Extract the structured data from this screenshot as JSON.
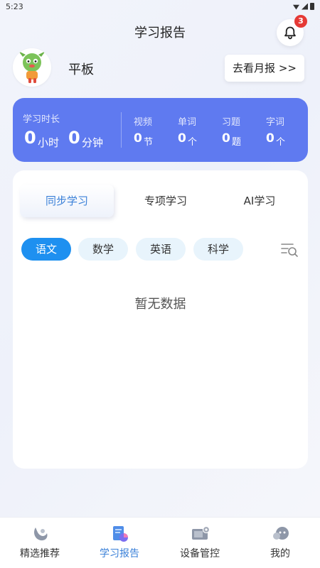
{
  "status_bar": {
    "time": "5:23"
  },
  "header": {
    "title": "学习报告",
    "notification_count": "3"
  },
  "profile": {
    "name": "平板",
    "report_button": "去看月报 >>"
  },
  "stats": {
    "study_time_label": "学习时长",
    "hours_value": "0",
    "hours_unit": "小时",
    "minutes_value": "0",
    "minutes_unit": "分钟",
    "items": [
      {
        "label": "视频",
        "value": "0",
        "unit": "节"
      },
      {
        "label": "单词",
        "value": "0",
        "unit": "个"
      },
      {
        "label": "习题",
        "value": "0",
        "unit": "题"
      },
      {
        "label": "字词",
        "value": "0",
        "unit": "个"
      }
    ]
  },
  "tabs": [
    {
      "label": "同步学习",
      "active": true
    },
    {
      "label": "专项学习",
      "active": false
    },
    {
      "label": "AI学习",
      "active": false
    }
  ],
  "subjects": [
    {
      "label": "语文",
      "active": true
    },
    {
      "label": "数学",
      "active": false
    },
    {
      "label": "英语",
      "active": false
    },
    {
      "label": "科学",
      "active": false
    }
  ],
  "empty_state": "暂无数据",
  "bottom_nav": [
    {
      "label": "精选推荐",
      "icon": "featured-icon",
      "active": false
    },
    {
      "label": "学习报告",
      "icon": "report-icon",
      "active": true
    },
    {
      "label": "设备管控",
      "icon": "device-control-icon",
      "active": false
    },
    {
      "label": "我的",
      "icon": "profile-icon",
      "active": false
    }
  ],
  "colors": {
    "accent": "#3a80d8",
    "stats_card": "#5f7af0",
    "chip_active": "#1e90f0",
    "badge": "#e53935"
  }
}
